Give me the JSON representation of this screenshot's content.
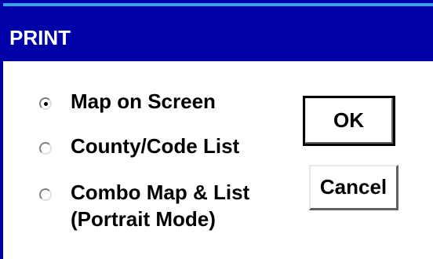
{
  "window": {
    "title": "PRINT"
  },
  "options": [
    {
      "label": "Map on Screen",
      "selected": true
    },
    {
      "label": "County/Code List",
      "selected": false
    },
    {
      "label": "Combo Map & List",
      "sublabel": "(Portrait Mode)",
      "selected": false
    }
  ],
  "buttons": {
    "ok": "OK",
    "cancel": "Cancel"
  },
  "colors": {
    "titlebar": "#0000a8",
    "titlebar_highlight": "#3aa0e8",
    "background": "#ffffff"
  }
}
